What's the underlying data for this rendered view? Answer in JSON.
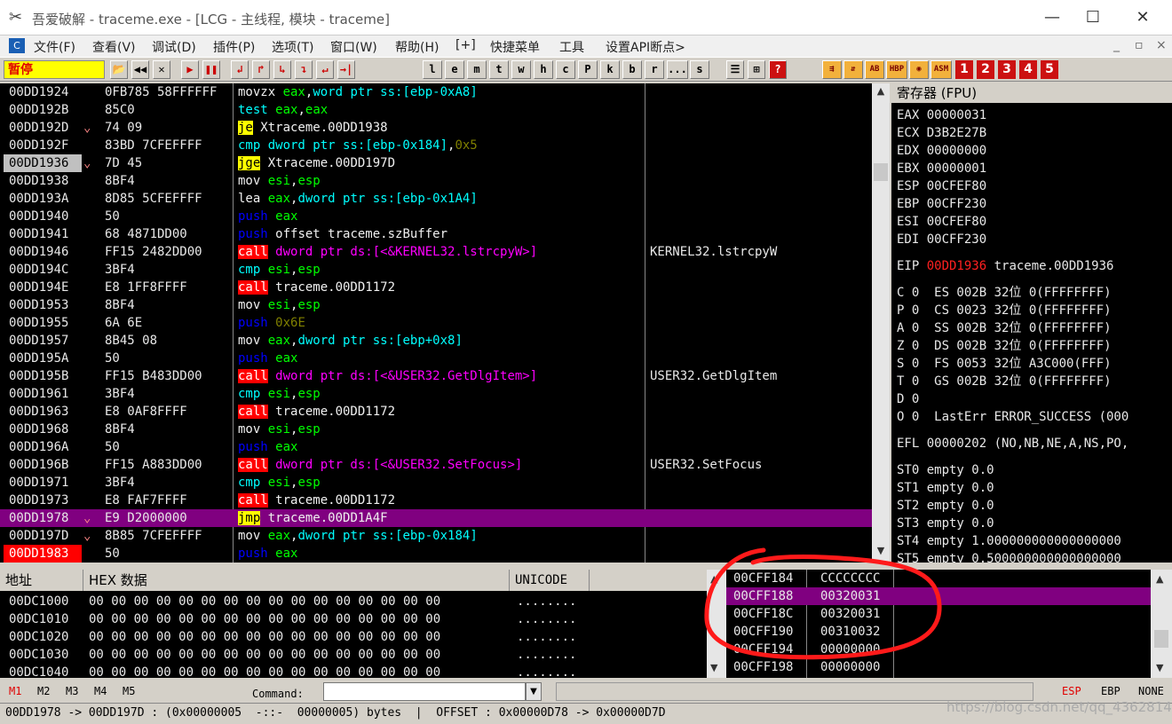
{
  "window": {
    "title": "吾爱破解 - traceme.exe - [LCG - 主线程, 模块 - traceme]",
    "minimize": "—",
    "maximize": "☐",
    "close": "✕"
  },
  "menu": [
    "文件(F)",
    "查看(V)",
    "调试(D)",
    "插件(P)",
    "选项(T)",
    "窗口(W)",
    "帮助(H)",
    "[+]",
    "快捷菜单",
    "工具",
    "设置API断点>"
  ],
  "mdi_buttons": [
    "_",
    "▫",
    "×"
  ],
  "toolbar": {
    "status": "暂停",
    "nav_buttons": [
      "📂",
      "◀◀",
      "✕",
      "▶",
      "❚❚",
      "↲",
      "↱",
      "↳",
      "↴",
      "↵",
      "→|"
    ],
    "letters": [
      "l",
      "e",
      "m",
      "t",
      "w",
      "h",
      "c",
      "P",
      "k",
      "b",
      "r",
      "...",
      "s"
    ],
    "extra": [
      "☰",
      "⊞",
      "?"
    ],
    "plugins": [
      "⇶",
      "⇵",
      "AB",
      "HBP",
      "◉",
      "ASM"
    ],
    "numbers": [
      "1",
      "2",
      "3",
      "4",
      "5"
    ]
  },
  "disasm": [
    {
      "addr": "00DD1924",
      "arrow": "",
      "hex": "0FB785 58FFFFFF",
      "tokens": [
        [
          "movzx ",
          "#f0f0f0"
        ],
        [
          "eax",
          "#00ff00"
        ],
        [
          ",",
          "#f0f0f0"
        ],
        [
          "word ptr ss:[ebp-0xA8]",
          "#00ffff"
        ]
      ],
      "comment": ""
    },
    {
      "addr": "00DD192B",
      "arrow": "",
      "hex": "85C0",
      "tokens": [
        [
          "test ",
          "#00ffff"
        ],
        [
          "eax",
          "#00ff00"
        ],
        [
          ",",
          "#f0f0f0"
        ],
        [
          "eax",
          "#00ff00"
        ]
      ],
      "comment": ""
    },
    {
      "addr": "00DD192D",
      "arrow": "v",
      "hex": "74 09",
      "tokens": [
        [
          "je",
          "#000000",
          "#ffff00"
        ],
        [
          " Xtraceme.00DD1938",
          "#f0f0f0"
        ]
      ],
      "comment": ""
    },
    {
      "addr": "00DD192F",
      "arrow": "",
      "hex": "83BD 7CFEFFFF",
      "tokens": [
        [
          "cmp ",
          "#00ffff"
        ],
        [
          "dword ptr ss:[ebp-0x184]",
          "#00ffff"
        ],
        [
          ",",
          "#f0f0f0"
        ],
        [
          "0x5",
          "#808000"
        ]
      ],
      "comment": ""
    },
    {
      "addr": "00DD1936",
      "arrow": "v",
      "hex": "7D 45",
      "tokens": [
        [
          "jge",
          "#000000",
          "#ffff00"
        ],
        [
          " Xtraceme.00DD197D",
          "#f0f0f0"
        ]
      ],
      "comment": "",
      "eip": true
    },
    {
      "addr": "00DD1938",
      "arrow": "",
      "hex": "8BF4",
      "tokens": [
        [
          "mov ",
          "#f0f0f0"
        ],
        [
          "esi",
          "#00ff00"
        ],
        [
          ",",
          "#f0f0f0"
        ],
        [
          "esp",
          "#00ff00"
        ]
      ],
      "comment": ""
    },
    {
      "addr": "00DD193A",
      "arrow": "",
      "hex": "8D85 5CFEFFFF",
      "tokens": [
        [
          "lea ",
          "#f0f0f0"
        ],
        [
          "eax",
          "#00ff00"
        ],
        [
          ",",
          "#f0f0f0"
        ],
        [
          "dword ptr ss:[ebp-0x1A4]",
          "#00ffff"
        ]
      ],
      "comment": ""
    },
    {
      "addr": "00DD1940",
      "arrow": "",
      "hex": "50",
      "tokens": [
        [
          "push ",
          "#0000ff"
        ],
        [
          "eax",
          "#00ff00"
        ]
      ],
      "comment": ""
    },
    {
      "addr": "00DD1941",
      "arrow": "",
      "hex": "68 4871DD00",
      "tokens": [
        [
          "push ",
          "#0000ff"
        ],
        [
          "offset traceme.szBuffer",
          "#f0f0f0"
        ]
      ],
      "comment": ""
    },
    {
      "addr": "00DD1946",
      "arrow": "",
      "hex": "FF15 2482DD00",
      "tokens": [
        [
          "call",
          "#ffffff",
          "#ff0000"
        ],
        [
          " dword ptr ds:[<&KERNEL32.lstrcpyW>]",
          "#ff00ff"
        ]
      ],
      "comment": "KERNEL32.lstrcpyW"
    },
    {
      "addr": "00DD194C",
      "arrow": "",
      "hex": "3BF4",
      "tokens": [
        [
          "cmp ",
          "#00ffff"
        ],
        [
          "esi",
          "#00ff00"
        ],
        [
          ",",
          "#f0f0f0"
        ],
        [
          "esp",
          "#00ff00"
        ]
      ],
      "comment": ""
    },
    {
      "addr": "00DD194E",
      "arrow": "",
      "hex": "E8 1FF8FFFF",
      "tokens": [
        [
          "call",
          "#ffffff",
          "#ff0000"
        ],
        [
          " traceme.00DD1172",
          "#f0f0f0"
        ]
      ],
      "comment": ""
    },
    {
      "addr": "00DD1953",
      "arrow": "",
      "hex": "8BF4",
      "tokens": [
        [
          "mov ",
          "#f0f0f0"
        ],
        [
          "esi",
          "#00ff00"
        ],
        [
          ",",
          "#f0f0f0"
        ],
        [
          "esp",
          "#00ff00"
        ]
      ],
      "comment": ""
    },
    {
      "addr": "00DD1955",
      "arrow": "",
      "hex": "6A 6E",
      "tokens": [
        [
          "push ",
          "#0000ff"
        ],
        [
          "0x6E",
          "#808000"
        ]
      ],
      "comment": ""
    },
    {
      "addr": "00DD1957",
      "arrow": "",
      "hex": "8B45 08",
      "tokens": [
        [
          "mov ",
          "#f0f0f0"
        ],
        [
          "eax",
          "#00ff00"
        ],
        [
          ",",
          "#f0f0f0"
        ],
        [
          "dword ptr ss:[ebp+0x8]",
          "#00ffff"
        ]
      ],
      "comment": ""
    },
    {
      "addr": "00DD195A",
      "arrow": "",
      "hex": "50",
      "tokens": [
        [
          "push ",
          "#0000ff"
        ],
        [
          "eax",
          "#00ff00"
        ]
      ],
      "comment": ""
    },
    {
      "addr": "00DD195B",
      "arrow": "",
      "hex": "FF15 B483DD00",
      "tokens": [
        [
          "call",
          "#ffffff",
          "#ff0000"
        ],
        [
          " dword ptr ds:[<&USER32.GetDlgItem>]",
          "#ff00ff"
        ]
      ],
      "comment": "USER32.GetDlgItem"
    },
    {
      "addr": "00DD1961",
      "arrow": "",
      "hex": "3BF4",
      "tokens": [
        [
          "cmp ",
          "#00ffff"
        ],
        [
          "esi",
          "#00ff00"
        ],
        [
          ",",
          "#f0f0f0"
        ],
        [
          "esp",
          "#00ff00"
        ]
      ],
      "comment": ""
    },
    {
      "addr": "00DD1963",
      "arrow": "",
      "hex": "E8 0AF8FFFF",
      "tokens": [
        [
          "call",
          "#ffffff",
          "#ff0000"
        ],
        [
          " traceme.00DD1172",
          "#f0f0f0"
        ]
      ],
      "comment": ""
    },
    {
      "addr": "00DD1968",
      "arrow": "",
      "hex": "8BF4",
      "tokens": [
        [
          "mov ",
          "#f0f0f0"
        ],
        [
          "esi",
          "#00ff00"
        ],
        [
          ",",
          "#f0f0f0"
        ],
        [
          "esp",
          "#00ff00"
        ]
      ],
      "comment": ""
    },
    {
      "addr": "00DD196A",
      "arrow": "",
      "hex": "50",
      "tokens": [
        [
          "push ",
          "#0000ff"
        ],
        [
          "eax",
          "#00ff00"
        ]
      ],
      "comment": ""
    },
    {
      "addr": "00DD196B",
      "arrow": "",
      "hex": "FF15 A883DD00",
      "tokens": [
        [
          "call",
          "#ffffff",
          "#ff0000"
        ],
        [
          " dword ptr ds:[<&USER32.SetFocus>]",
          "#ff00ff"
        ]
      ],
      "comment": "USER32.SetFocus"
    },
    {
      "addr": "00DD1971",
      "arrow": "",
      "hex": "3BF4",
      "tokens": [
        [
          "cmp ",
          "#00ffff"
        ],
        [
          "esi",
          "#00ff00"
        ],
        [
          ",",
          "#f0f0f0"
        ],
        [
          "esp",
          "#00ff00"
        ]
      ],
      "comment": ""
    },
    {
      "addr": "00DD1973",
      "arrow": "",
      "hex": "E8 FAF7FFFF",
      "tokens": [
        [
          "call",
          "#ffffff",
          "#ff0000"
        ],
        [
          " traceme.00DD1172",
          "#f0f0f0"
        ]
      ],
      "comment": ""
    },
    {
      "addr": "00DD1978",
      "arrow": "v",
      "hex": "E9 D2000000",
      "tokens": [
        [
          "jmp",
          "#000000",
          "#ffff00"
        ],
        [
          " traceme.00DD1A4F",
          "#f0f0f0"
        ]
      ],
      "comment": "",
      "selected": true
    },
    {
      "addr": "00DD197D",
      "arrow": "v",
      "hex": "8B85 7CFEFFFF",
      "tokens": [
        [
          "mov ",
          "#f0f0f0"
        ],
        [
          "eax",
          "#00ff00"
        ],
        [
          ",",
          "#f0f0f0"
        ],
        [
          "dword ptr ss:[ebp-0x184]",
          "#00ffff"
        ]
      ],
      "comment": ""
    },
    {
      "addr": "00DD1983",
      "arrow": "",
      "hex": "50",
      "tokens": [
        [
          "push ",
          "#0000ff"
        ],
        [
          "eax",
          "#00ff00"
        ]
      ],
      "comment": "",
      "breakpoint": true
    }
  ],
  "registers": {
    "title": "寄存器 (FPU)",
    "lines": [
      {
        "text": "EAX 00000031"
      },
      {
        "text": "ECX D3B2E27B"
      },
      {
        "text": "EDX 00000000"
      },
      {
        "text": "EBX 00000001"
      },
      {
        "text": "ESP 00CFEF80"
      },
      {
        "text": "EBP 00CFF230"
      },
      {
        "text": "ESI 00CFEF80"
      },
      {
        "text": "EDI 00CFF230"
      },
      {
        "text": ""
      },
      {
        "text": "EIP ",
        "red": "00DD1936",
        "rest": " traceme.00DD1936"
      },
      {
        "text": ""
      },
      {
        "text": "C 0  ES 002B 32位 0(FFFFFFFF)"
      },
      {
        "text": "P 0  CS 0023 32位 0(FFFFFFFF)"
      },
      {
        "text": "A 0  SS 002B 32位 0(FFFFFFFF)"
      },
      {
        "text": "Z 0  DS 002B 32位 0(FFFFFFFF)"
      },
      {
        "text": "S 0  FS 0053 32位 A3C000(FFF)"
      },
      {
        "text": "T 0  GS 002B 32位 0(FFFFFFFF)"
      },
      {
        "text": "D 0"
      },
      {
        "text": "O 0  LastErr ERROR_SUCCESS (000"
      },
      {
        "text": ""
      },
      {
        "text": "EFL 00000202 (NO,NB,NE,A,NS,PO,"
      },
      {
        "text": ""
      },
      {
        "text": "ST0 empty 0.0"
      },
      {
        "text": "ST1 empty 0.0"
      },
      {
        "text": "ST2 empty 0.0"
      },
      {
        "text": "ST3 empty 0.0"
      },
      {
        "text": "ST4 empty 1.000000000000000000"
      },
      {
        "text": "ST5 empty 0.500000000000000000"
      }
    ]
  },
  "dump": {
    "headers": [
      "地址",
      "HEX 数据",
      "UNICODE"
    ],
    "rows": [
      {
        "addr": "00DC1000",
        "hex": "00 00 00 00 00 00 00 00 00 00 00 00 00 00 00 00",
        "uni": "........"
      },
      {
        "addr": "00DC1010",
        "hex": "00 00 00 00 00 00 00 00 00 00 00 00 00 00 00 00",
        "uni": "........"
      },
      {
        "addr": "00DC1020",
        "hex": "00 00 00 00 00 00 00 00 00 00 00 00 00 00 00 00",
        "uni": "........"
      },
      {
        "addr": "00DC1030",
        "hex": "00 00 00 00 00 00 00 00 00 00 00 00 00 00 00 00",
        "uni": "........"
      },
      {
        "addr": "00DC1040",
        "hex": "00 00 00 00 00 00 00 00 00 00 00 00 00 00 00 00",
        "uni": "........"
      }
    ]
  },
  "stack": [
    {
      "addr": "00CFF184",
      "val": "CCCCCCCC"
    },
    {
      "addr": "00CFF188",
      "val": "00320031",
      "selected": true
    },
    {
      "addr": "00CFF18C",
      "val": "00320031"
    },
    {
      "addr": "00CFF190",
      "val": "00310032"
    },
    {
      "addr": "00CFF194",
      "val": "00000000"
    },
    {
      "addr": "00CFF198",
      "val": "00000000"
    }
  ],
  "cmdbar": {
    "modes": [
      "M1",
      "M2",
      "M3",
      "M4",
      "M5"
    ],
    "command_label": "Command:",
    "command_value": "",
    "regs": [
      "ESP",
      "EBP",
      "NONE"
    ]
  },
  "status": {
    "text": "00DD1978 -> 00DD197D : (0x00000005  -::-  00000005) bytes  |  OFFSET : 0x00000D78 -> 0x00000D7D",
    "watermark": "https://blog.csdn.net/qq_43628140"
  }
}
